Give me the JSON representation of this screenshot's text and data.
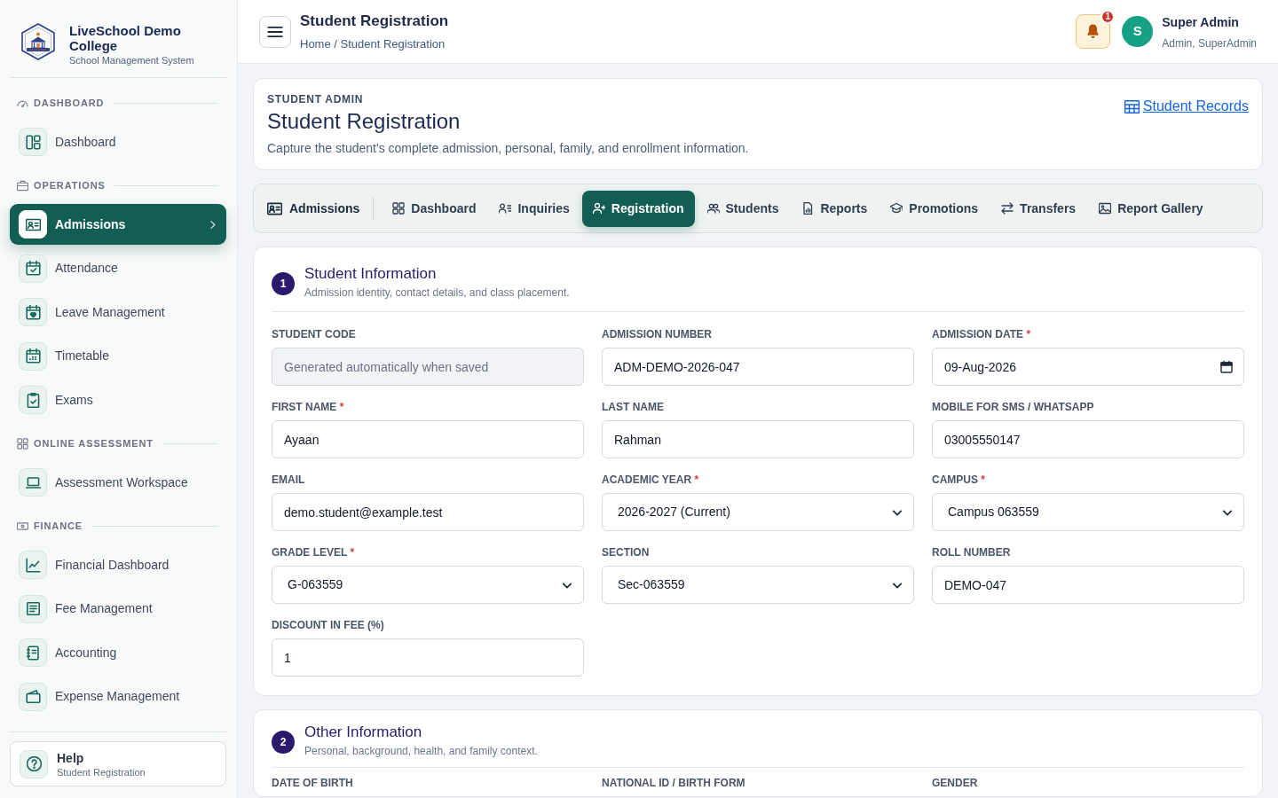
{
  "sidebar": {
    "brand": {
      "name": "LiveSchool Demo College",
      "tagline": "School Management System"
    },
    "sections": [
      {
        "title": "DASHBOARD",
        "items": [
          {
            "label": "Dashboard",
            "selected": false
          }
        ]
      },
      {
        "title": "OPERATIONS",
        "items": [
          {
            "label": "Admissions",
            "selected": true
          },
          {
            "label": "Attendance",
            "selected": false
          },
          {
            "label": "Leave Management",
            "selected": false
          },
          {
            "label": "Timetable",
            "selected": false
          },
          {
            "label": "Exams",
            "selected": false
          }
        ]
      },
      {
        "title": "ONLINE ASSESSMENT",
        "items": [
          {
            "label": "Assessment Workspace",
            "selected": false
          }
        ]
      },
      {
        "title": "FINANCE",
        "items": [
          {
            "label": "Financial Dashboard",
            "selected": false
          },
          {
            "label": "Fee Management",
            "selected": false
          },
          {
            "label": "Accounting",
            "selected": false
          },
          {
            "label": "Expense Management",
            "selected": false
          }
        ]
      }
    ],
    "help": {
      "title": "Help",
      "subtitle": "Student Registration"
    }
  },
  "header": {
    "title": "Student Registration",
    "breadcrumb": "Home / Student Registration",
    "notification_count": "1",
    "user": {
      "initial": "S",
      "name": "Super Admin",
      "roles": "Admin, SuperAdmin"
    }
  },
  "page_header": {
    "eyebrow": "STUDENT ADMIN",
    "title": "Student Registration",
    "description": "Capture the student's complete admission, personal, family, and enrollment information.",
    "link": "Student Records"
  },
  "tabs": {
    "module": "Admissions",
    "items": [
      {
        "label": "Dashboard",
        "selected": false
      },
      {
        "label": "Inquiries",
        "selected": false
      },
      {
        "label": "Registration",
        "selected": true
      },
      {
        "label": "Students",
        "selected": false
      },
      {
        "label": "Reports",
        "selected": false
      },
      {
        "label": "Promotions",
        "selected": false
      },
      {
        "label": "Transfers",
        "selected": false
      },
      {
        "label": "Report Gallery",
        "selected": false
      }
    ]
  },
  "form_sections": [
    {
      "number": "1",
      "title": "Student Information",
      "subtitle": "Admission identity, contact details, and class placement.",
      "fields": [
        {
          "label": "STUDENT CODE",
          "kind": "text",
          "placeholder": "Generated automatically when saved",
          "disabled": true
        },
        {
          "label": "ADMISSION NUMBER",
          "kind": "text",
          "value": "ADM-DEMO-2026-047",
          "disabled": false
        },
        {
          "label": "ADMISSION DATE",
          "required_mark": "*",
          "kind": "date",
          "value": "09-Aug-2026",
          "disabled": false
        },
        {
          "label": "FIRST NAME",
          "required_mark": "*",
          "kind": "text",
          "value": "Ayaan",
          "disabled": false
        },
        {
          "label": "LAST NAME",
          "kind": "text",
          "value": "Rahman",
          "disabled": false
        },
        {
          "label": "MOBILE FOR SMS / WHATSAPP",
          "kind": "text",
          "value": "03005550147",
          "disabled": false
        },
        {
          "label": "EMAIL",
          "kind": "text",
          "value": "demo.student@example.test",
          "disabled": false
        },
        {
          "label": "ACADEMIC YEAR",
          "required_mark": "*",
          "kind": "select",
          "value": "2026-2027 (Current)",
          "disabled": false
        },
        {
          "label": "CAMPUS",
          "required_mark": "*",
          "kind": "select",
          "value": "Campus 063559",
          "disabled": false
        },
        {
          "label": "GRADE LEVEL",
          "required_mark": "*",
          "kind": "select",
          "value": "G-063559",
          "disabled": false
        },
        {
          "label": "SECTION",
          "kind": "select",
          "value": "Sec-063559",
          "disabled": false
        },
        {
          "label": "ROLL NUMBER",
          "kind": "text",
          "value": "DEMO-047",
          "disabled": false
        },
        {
          "label": "DISCOUNT IN FEE (%)",
          "kind": "text",
          "value": "1",
          "disabled": false
        }
      ]
    },
    {
      "number": "2",
      "title": "Other Information",
      "subtitle": "Personal, background, health, and family context.",
      "fields": [
        {
          "label": "DATE OF BIRTH"
        },
        {
          "label": "NATIONAL ID / BIRTH FORM"
        },
        {
          "label": "GENDER"
        }
      ]
    }
  ]
}
